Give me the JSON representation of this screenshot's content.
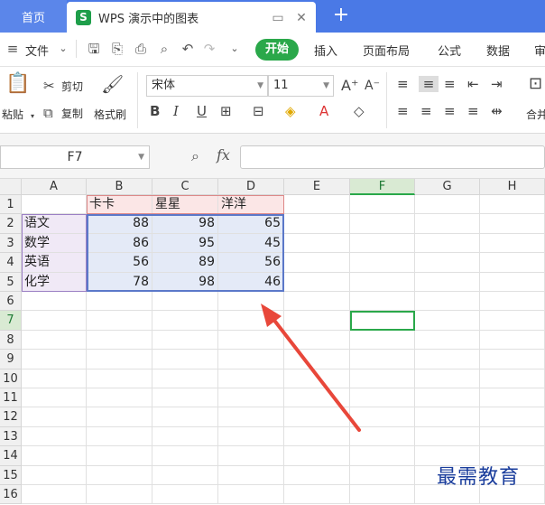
{
  "tabs": {
    "home_label": "首页",
    "doc_logo": "S",
    "doc_title": "WPS 演示中的图表",
    "new_tab": "+"
  },
  "menu": {
    "file_label": "文件",
    "items": [
      "开始",
      "插入",
      "页面布局",
      "公式",
      "数据",
      "审"
    ]
  },
  "ribbon": {
    "paste_label": "粘贴",
    "cut_label": "剪切",
    "copy_label": "复制",
    "format_painter_label": "格式刷",
    "font_name": "宋体",
    "font_size": "11",
    "bold": "B",
    "italic": "I",
    "underline": "U",
    "merge_label": "合并"
  },
  "formula_bar": {
    "name_box": "F7",
    "fx_label": "fx",
    "formula": ""
  },
  "grid": {
    "columns": [
      "A",
      "B",
      "C",
      "D",
      "E",
      "F",
      "G",
      "H"
    ],
    "selected_column": "F",
    "selected_row": "7",
    "rows": [
      "1",
      "2",
      "3",
      "4",
      "5",
      "6",
      "7",
      "8",
      "9",
      "10",
      "11",
      "12",
      "13",
      "14",
      "15",
      "16"
    ],
    "header_row": [
      "",
      "卡卡",
      "星星",
      "洋洋"
    ],
    "data": [
      {
        "label": "语文",
        "values": [
          88,
          98,
          65
        ]
      },
      {
        "label": "数学",
        "values": [
          86,
          95,
          45
        ]
      },
      {
        "label": "英语",
        "values": [
          56,
          89,
          56
        ]
      },
      {
        "label": "化学",
        "values": [
          78,
          98,
          46
        ]
      }
    ]
  },
  "watermark": "最需教育",
  "colors": {
    "tab_bar": "#4a79e6",
    "accent_green": "#2aa84a",
    "arrow_red": "#e8473a",
    "range_blue": "#5b78c9"
  }
}
